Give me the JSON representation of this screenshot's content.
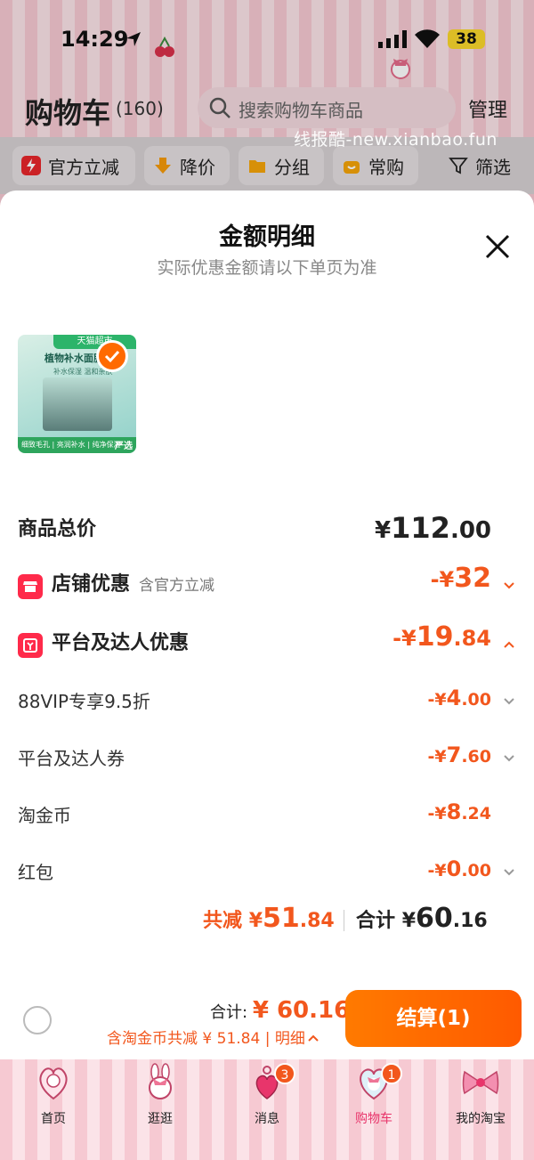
{
  "status_bar": {
    "time": "14:29",
    "battery": "38"
  },
  "header": {
    "title": "购物车",
    "count": "(160)",
    "search_placeholder": "搜索购物车商品",
    "manage_label": "管理",
    "watermark": "线报酷-new.xianbao.fun"
  },
  "filters": [
    {
      "label": "官方立减",
      "icon": "lightning-icon"
    },
    {
      "label": "降价",
      "icon": "price-down-icon"
    },
    {
      "label": "分组",
      "icon": "folder-icon"
    },
    {
      "label": "常购",
      "icon": "bag-icon"
    },
    {
      "label": "筛选",
      "icon": "filter-icon"
    }
  ],
  "sheet": {
    "title": "金额明细",
    "subtitle": "实际优惠金额请以下单页为准",
    "product": {
      "badge": "天猫超市",
      "title": "植物补水面膜4",
      "subtitle": "补水保湿 温和亲肤",
      "footer": "细致毛孔 | 亮润补水 | 纯净保湿",
      "tag": "严选"
    },
    "rows": {
      "total_price": {
        "label": "商品总价",
        "currency": "¥",
        "int": "112",
        "dec": ".00"
      },
      "store_discount": {
        "label": "店铺优惠",
        "sub": "含官方立减",
        "prefix": "-¥",
        "int": "32",
        "dec": ""
      },
      "platform_discount": {
        "label": "平台及达人优惠",
        "prefix": "-¥",
        "int": "19",
        "dec": ".84"
      },
      "vip": {
        "label": "88VIP专享9.5折",
        "prefix": "-¥",
        "int": "4",
        "dec": ".00"
      },
      "platform_coupon": {
        "label": "平台及达人券",
        "prefix": "-¥",
        "int": "7",
        "dec": ".60"
      },
      "taojinbi": {
        "label": "淘金币",
        "prefix": "-¥",
        "int": "8",
        "dec": ".24"
      },
      "red_packet": {
        "label": "红包",
        "prefix": "-¥",
        "int": "0",
        "dec": ".00"
      }
    },
    "summary": {
      "save_label": "共减",
      "save_prefix": "¥",
      "save_int": "51",
      "save_dec": ".84",
      "total_label": "合计",
      "total_prefix": "¥",
      "total_int": "60",
      "total_dec": ".16"
    }
  },
  "checkout": {
    "total_label": "合计:",
    "total_amount": "¥ 60.16",
    "detail": "含淘金币共减 ¥ 51.84 | 明细",
    "button": "结算(1)"
  },
  "tabs": [
    {
      "label": "首页",
      "icon": "mirror-icon",
      "badge": ""
    },
    {
      "label": "逛逛",
      "icon": "bunny-icon",
      "badge": ""
    },
    {
      "label": "消息",
      "icon": "heart-keychain-icon",
      "badge": "3"
    },
    {
      "label": "购物车",
      "icon": "heart-cart-icon",
      "badge": "1"
    },
    {
      "label": "我的淘宝",
      "icon": "bow-icon",
      "badge": ""
    }
  ],
  "colors": {
    "accent": "#f2571d",
    "checkout": "#ff6a00",
    "pink_bg": "#f6c9d2"
  }
}
